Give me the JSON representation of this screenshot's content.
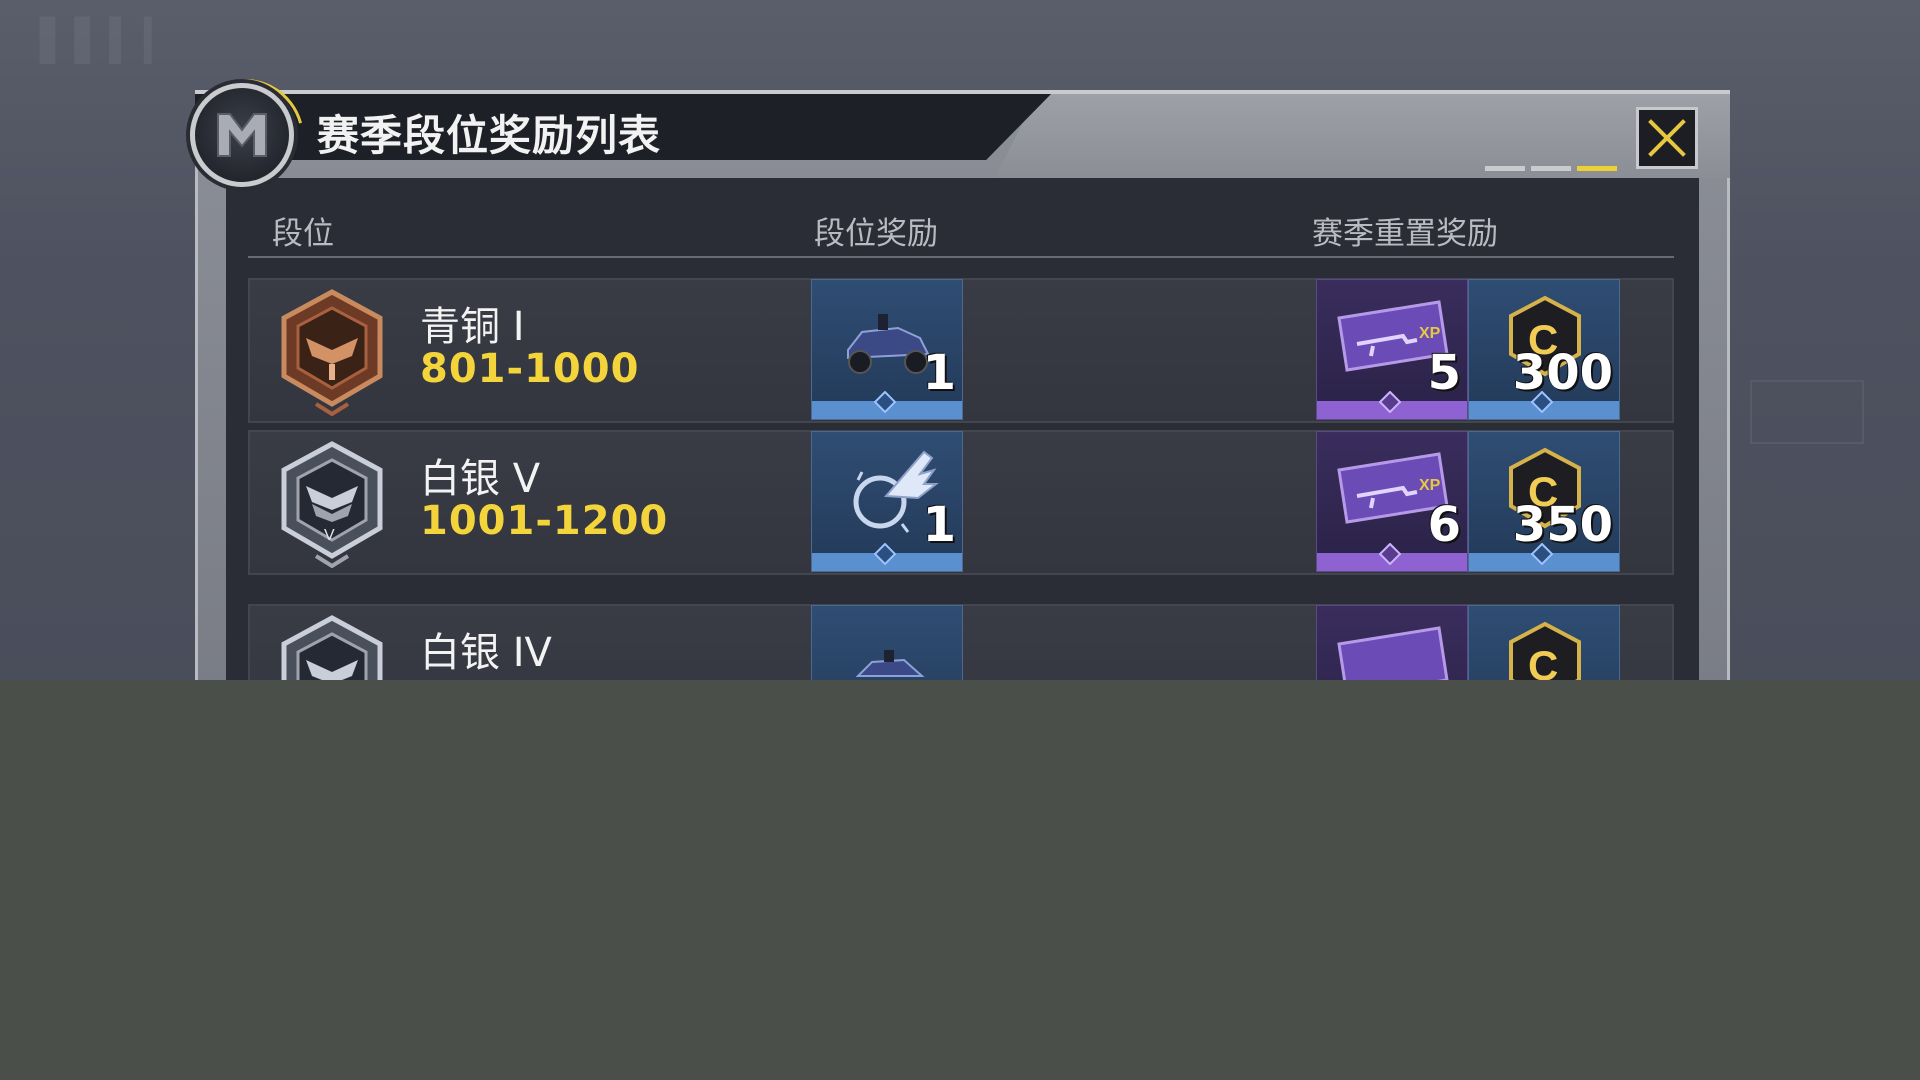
{
  "title": "赛季段位奖励列表",
  "columns": {
    "rank": "段位",
    "rank_reward": "段位奖励",
    "season_reset_reward": "赛季重置奖励"
  },
  "rows": [
    {
      "name": "青铜 I",
      "range": "801-1000",
      "tier_color": "#a8603f",
      "rank_reward": {
        "icon": "vehicle-skin-icon",
        "count": "1"
      },
      "reset_rewards": [
        {
          "icon": "weapon-xp-card-icon",
          "count": "5"
        },
        {
          "icon": "cod-credit-icon",
          "count": "300"
        }
      ]
    },
    {
      "name": "白银 V",
      "range": "1001-1200",
      "tier_color": "#9ea3ad",
      "rank_reward": {
        "icon": "winged-emblem-icon",
        "count": "1"
      },
      "reset_rewards": [
        {
          "icon": "weapon-xp-card-icon",
          "count": "6"
        },
        {
          "icon": "cod-credit-icon",
          "count": "350"
        }
      ]
    },
    {
      "name": "白银 IV",
      "range": "",
      "tier_color": "#9ea3ad",
      "rank_reward": {
        "icon": "vehicle-skin-icon",
        "count": ""
      },
      "reset_rewards": [
        {
          "icon": "weapon-xp-card-icon",
          "count": ""
        },
        {
          "icon": "cod-credit-icon",
          "count": ""
        }
      ]
    }
  ],
  "pager": {
    "pages": 3,
    "active": 3
  },
  "colors": {
    "accent": "#f3d53b",
    "close": "#e6c840"
  }
}
